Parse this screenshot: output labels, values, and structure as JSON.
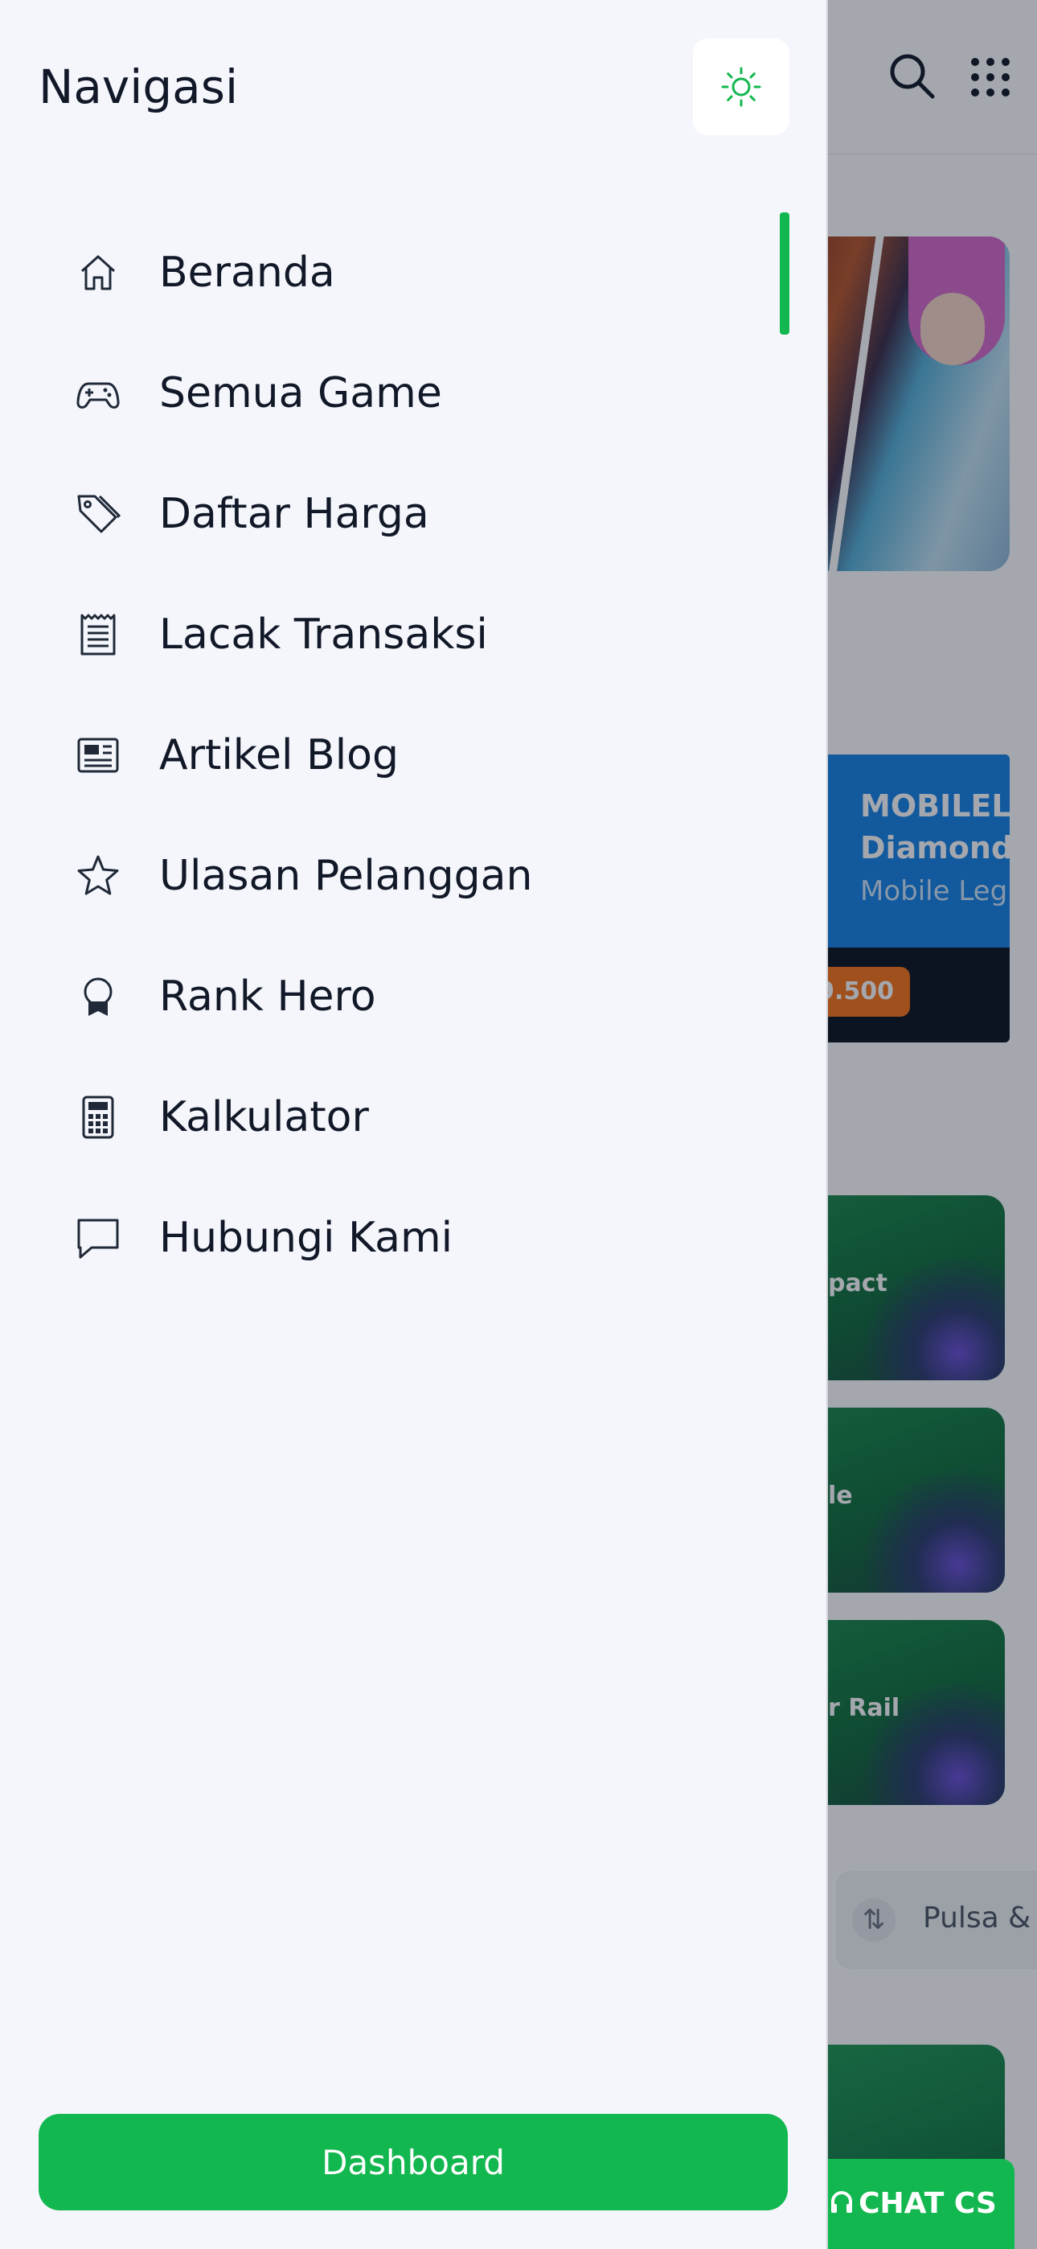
{
  "drawer": {
    "title": "Navigasi",
    "theme_toggle_icon": "sun-icon",
    "accent_color": "#12b74f",
    "items": [
      {
        "label": "Beranda",
        "icon": "home-icon",
        "active": true
      },
      {
        "label": "Semua Game",
        "icon": "gamepad-icon",
        "active": false
      },
      {
        "label": "Daftar Harga",
        "icon": "price-tag-icon",
        "active": false
      },
      {
        "label": "Lacak Transaksi",
        "icon": "receipt-icon",
        "active": false
      },
      {
        "label": "Artikel Blog",
        "icon": "newspaper-icon",
        "active": false
      },
      {
        "label": "Ulasan Pelanggan",
        "icon": "star-icon",
        "active": false
      },
      {
        "label": "Rank Hero",
        "icon": "award-icon",
        "active": false
      },
      {
        "label": "Kalkulator",
        "icon": "calculator-icon",
        "active": false
      },
      {
        "label": "Hubungi Kami",
        "icon": "chat-bubble-icon",
        "active": false
      }
    ],
    "dashboard_label": "Dashboard"
  },
  "background": {
    "product": {
      "title_line1": "MOBILEL",
      "title_line2": "Diamond",
      "subtitle": "Mobile Leg",
      "price": "9.500"
    },
    "game_cards": [
      "pact",
      "le",
      "r Rail"
    ],
    "category_pill": "Pulsa &",
    "chat_button": "CHAT CS"
  }
}
